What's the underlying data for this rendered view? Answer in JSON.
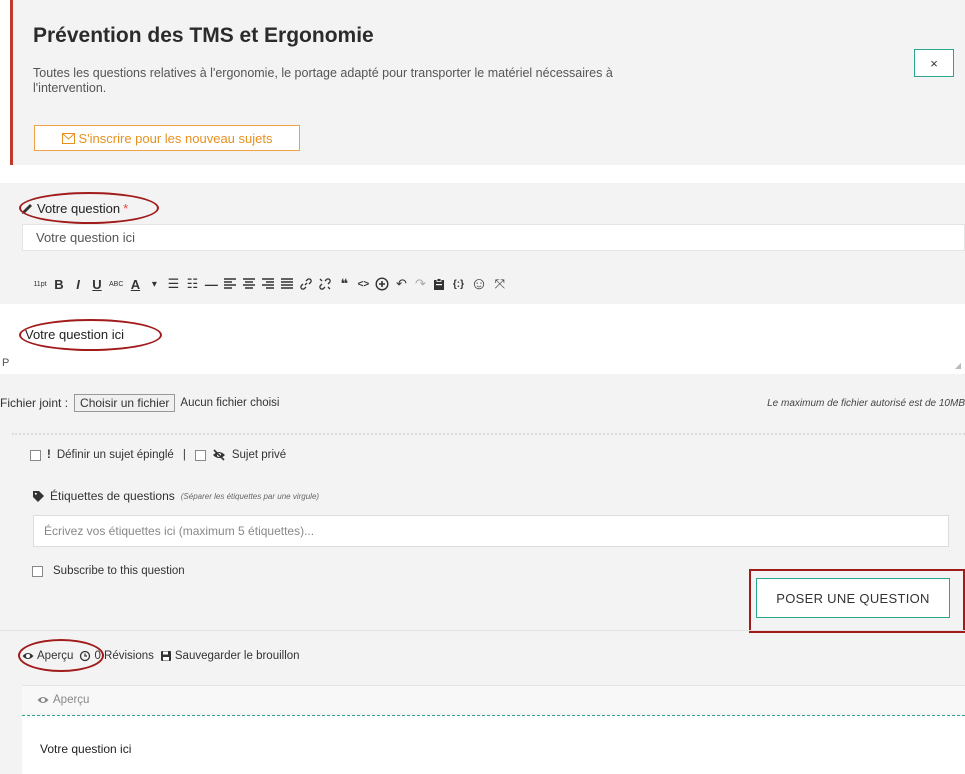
{
  "forum": {
    "title": "Prévention des TMS et Ergonomie",
    "description": "Toutes les questions relatives à l'ergonomie, le portage adapté pour transporter le matériel nécessaires à l'intervention.",
    "close_label": "×",
    "subscribe_label": "S'inscrire pour les nouveau sujets"
  },
  "question": {
    "label": "Votre question",
    "required_mark": "*",
    "placeholder": "Votre question ici"
  },
  "toolbar": {
    "font_size": "11pt",
    "bold": "B",
    "italic": "I",
    "underline": "U",
    "strikethrough": "ABC",
    "text_color": "A",
    "caret": "▾",
    "bullet_list": "☰",
    "numbered_list": "☷",
    "hr": "—",
    "blockquote": "❝",
    "code": "<>",
    "undo": "↶",
    "redo": "↷",
    "shortcode": "{:}",
    "emoji": "☺",
    "fullscreen": "⤧"
  },
  "editor": {
    "content": "Votre question ici",
    "path": "P",
    "grip": "◢"
  },
  "file": {
    "label": "Fichier joint :",
    "button": "Choisir un fichier",
    "none": "Aucun fichier choisi",
    "max": "Le maximum de fichier autorisé est de 10MB"
  },
  "options": {
    "pin_mark": "!",
    "pin_label": "Définir un sujet épinglé",
    "separator": "|",
    "private_label": "Sujet privé"
  },
  "tags": {
    "label": "Étiquettes de questions",
    "hint": "(Séparer les étiquettes par une virgule)",
    "placeholder": "Écrivez vos étiquettes ici (maximum 5 étiquettes)..."
  },
  "subscribe_question": {
    "label": "Subscribe to this question"
  },
  "submit": {
    "label": "POSER UNE QUESTION"
  },
  "actions": {
    "preview": "Aperçu",
    "revisions": "0 Révisions",
    "save_draft": "Sauvegarder le brouillon"
  },
  "preview": {
    "tab_label": "Aperçu",
    "content": "Votre question ici"
  },
  "colors": {
    "accent": "#2aa58e",
    "warning": "#e8901f",
    "annotation": "#a11b1b",
    "required": "#e74c3c"
  }
}
